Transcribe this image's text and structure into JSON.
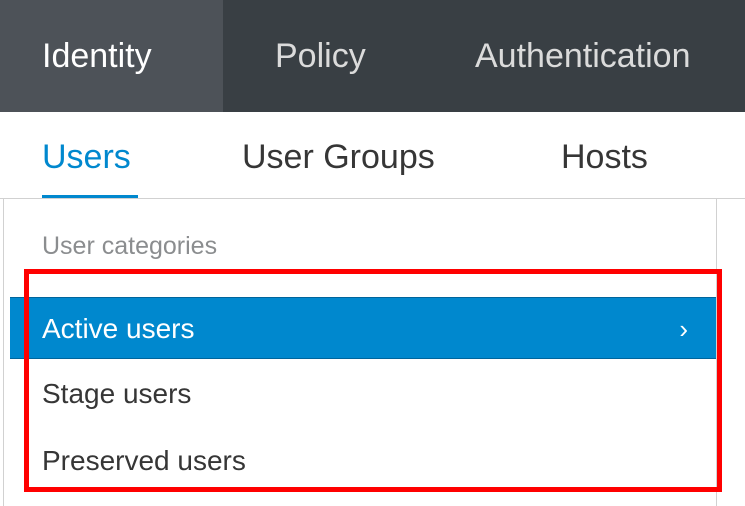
{
  "topnav": {
    "tabs": [
      {
        "label": "Identity",
        "active": true
      },
      {
        "label": "Policy",
        "active": false
      },
      {
        "label": "Authentication",
        "active": false
      }
    ]
  },
  "subnav": {
    "tabs": [
      {
        "label": "Users",
        "active": true
      },
      {
        "label": "User Groups",
        "active": false
      },
      {
        "label": "Hosts",
        "active": false
      }
    ]
  },
  "sidebar": {
    "heading": "User categories",
    "items": [
      {
        "label": "Active users",
        "active": true,
        "icon": "chevron-right-icon"
      },
      {
        "label": "Stage users",
        "active": false
      },
      {
        "label": "Preserved users",
        "active": false
      }
    ]
  },
  "colors": {
    "nav_background": "#393f44",
    "nav_active": "#4d5258",
    "accent": "#0088ce",
    "highlight": "#ff0000"
  }
}
